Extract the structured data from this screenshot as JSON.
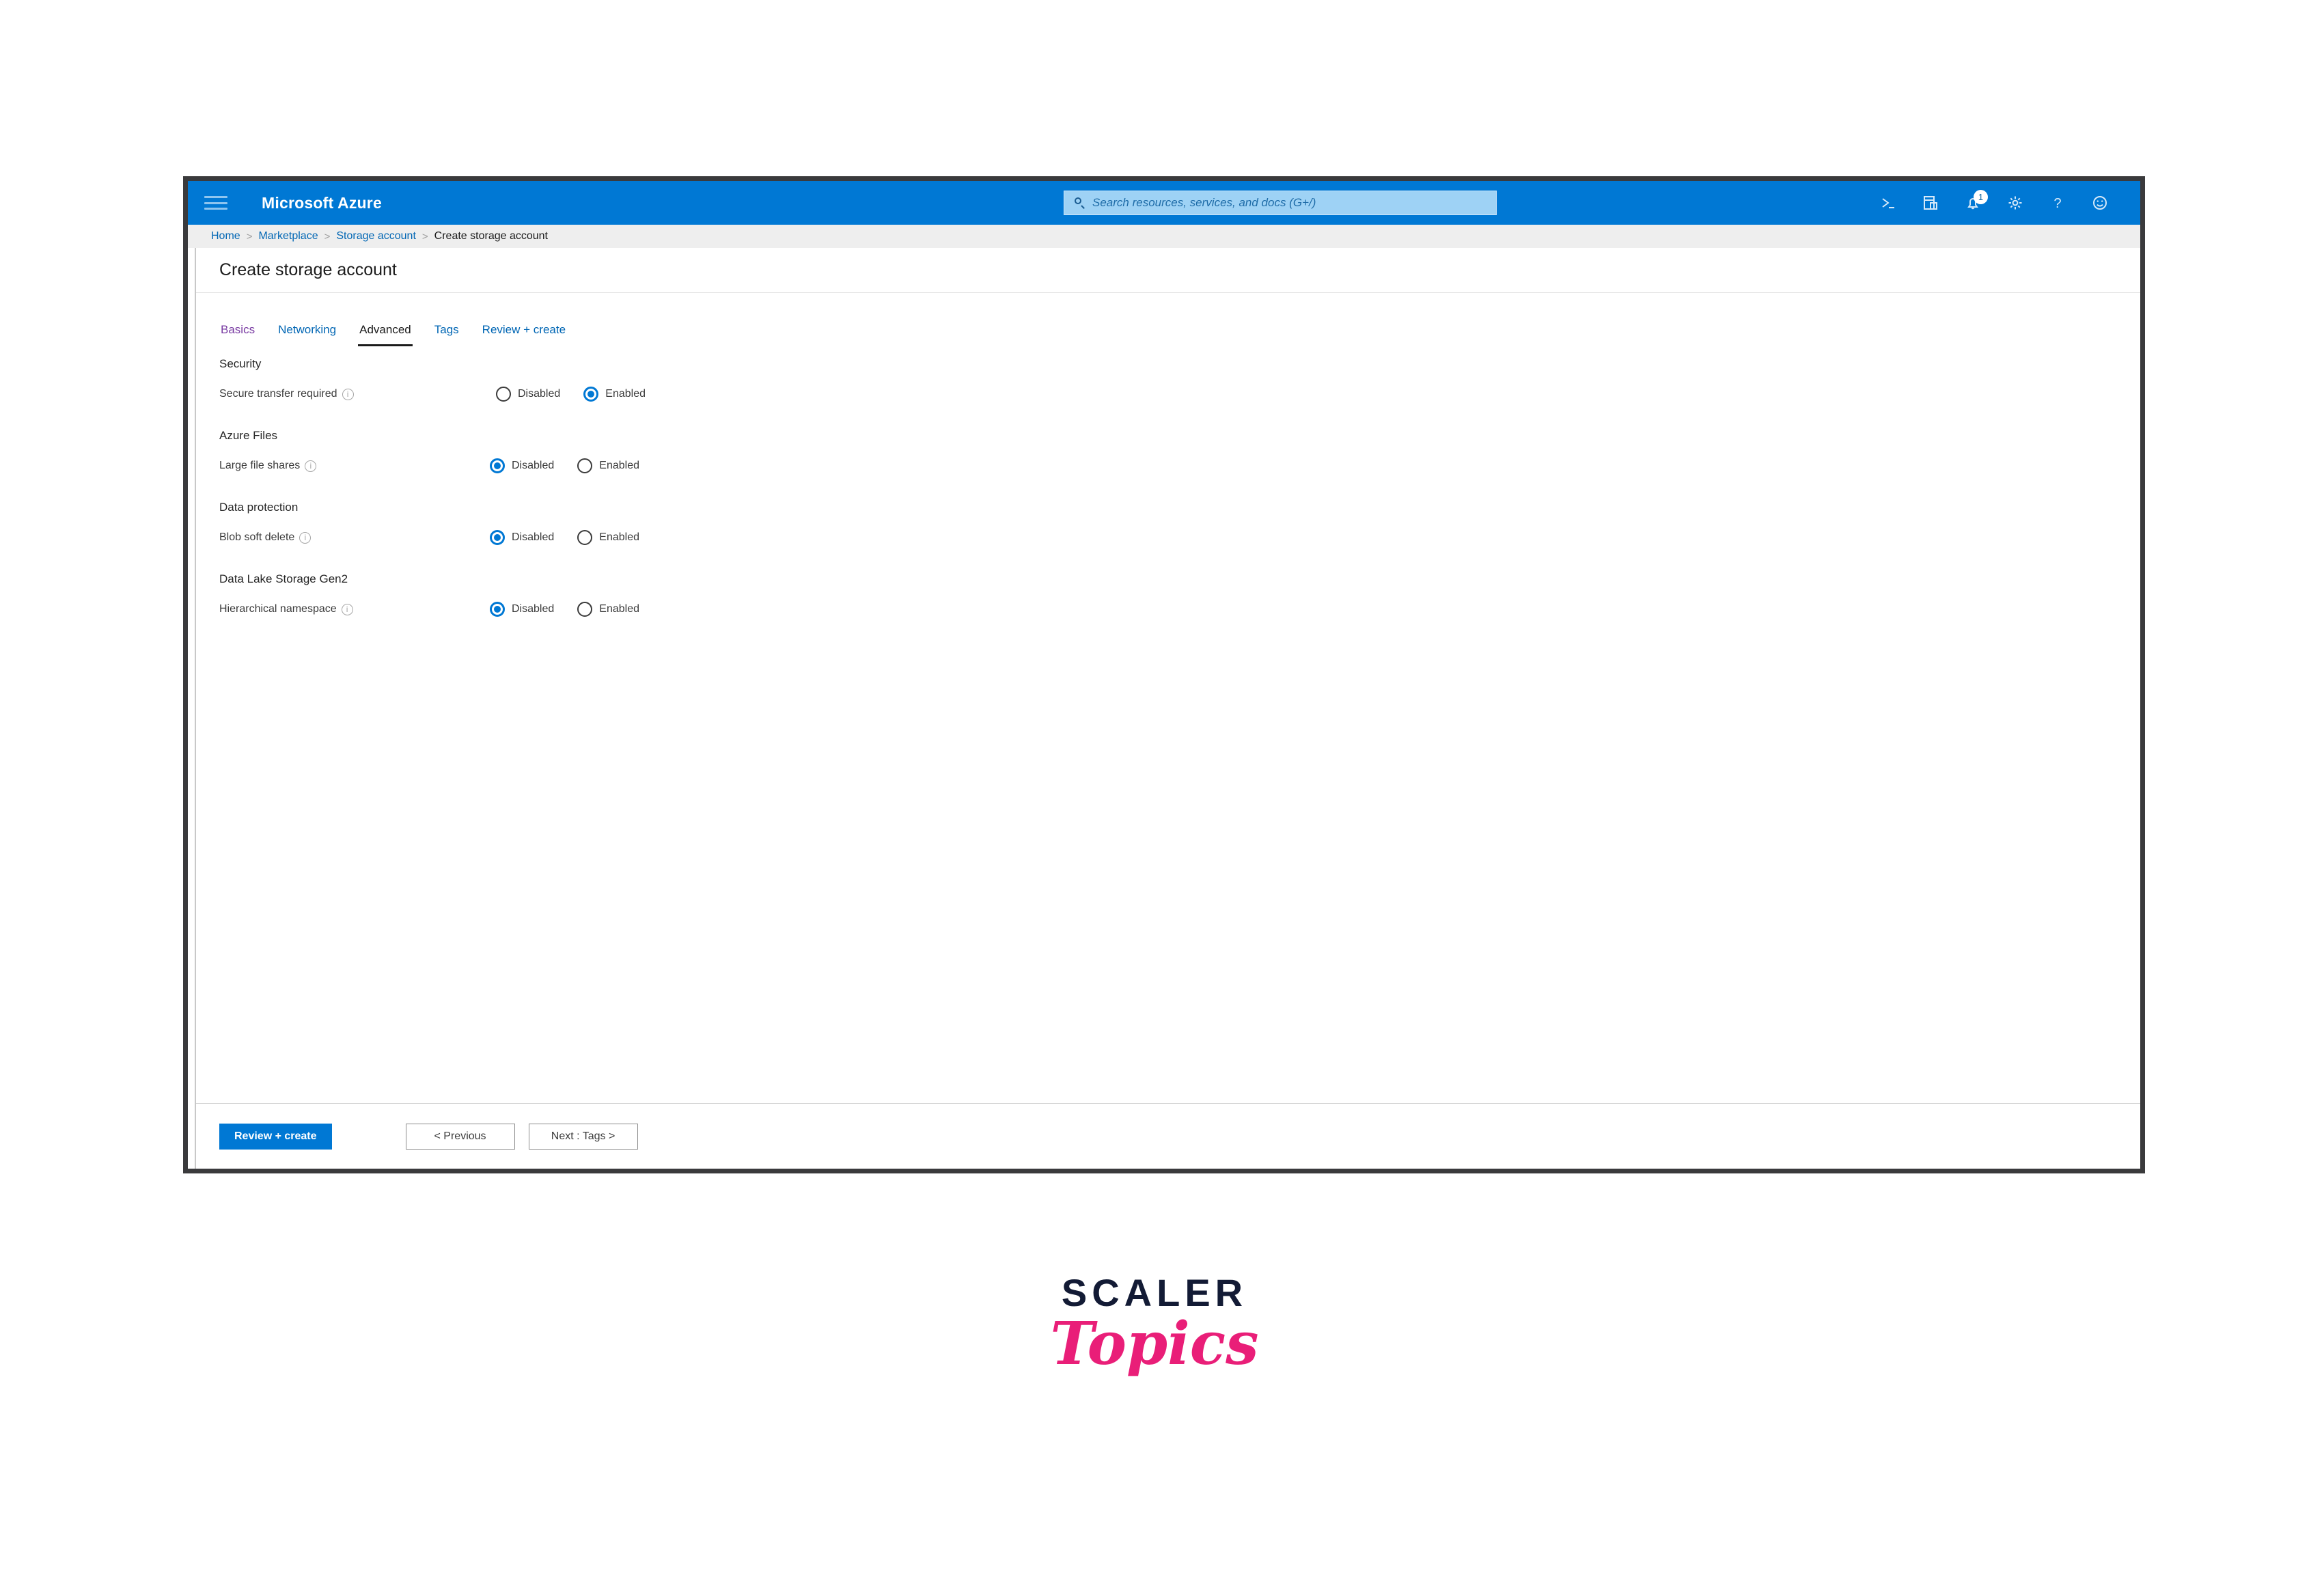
{
  "topbar": {
    "menu_icon": "hamburger-icon",
    "brand": "Microsoft Azure",
    "search": {
      "placeholder": "Search resources, services, and docs (G+/)",
      "value": "",
      "icon": "search-icon"
    },
    "icons": [
      {
        "name": "cloud-shell-icon",
        "glyph": ">_"
      },
      {
        "name": "directories-subscriptions-icon",
        "glyph": "filter"
      },
      {
        "name": "notifications-bell-icon",
        "glyph": "bell",
        "badge": "1"
      },
      {
        "name": "settings-gear-icon",
        "glyph": "gear"
      },
      {
        "name": "help-icon",
        "glyph": "?"
      },
      {
        "name": "feedback-smiley-icon",
        "glyph": "smiley"
      }
    ]
  },
  "breadcrumb": [
    {
      "label": "Home",
      "current": false
    },
    {
      "label": "Marketplace",
      "current": false
    },
    {
      "label": "Storage account",
      "current": false
    },
    {
      "label": "Create storage account",
      "current": true
    }
  ],
  "breadcrumb_separator": ">",
  "blade": {
    "title": "Create storage account",
    "tabs": [
      {
        "label": "Basics",
        "state": "visited"
      },
      {
        "label": "Networking",
        "state": "link"
      },
      {
        "label": "Advanced",
        "state": "active"
      },
      {
        "label": "Tags",
        "state": "link"
      },
      {
        "label": "Review + create",
        "state": "link"
      }
    ],
    "sections": [
      {
        "title": "Security",
        "field": {
          "label": "Secure transfer required",
          "info": "i",
          "options": [
            {
              "label": "Disabled",
              "checked": false
            },
            {
              "label": "Enabled",
              "checked": true
            }
          ]
        }
      },
      {
        "title": "Azure Files",
        "field": {
          "label": "Large file shares",
          "info": "i",
          "options": [
            {
              "label": "Disabled",
              "checked": true
            },
            {
              "label": "Enabled",
              "checked": false
            }
          ]
        }
      },
      {
        "title": "Data protection",
        "field": {
          "label": "Blob soft delete",
          "info": "i",
          "options": [
            {
              "label": "Disabled",
              "checked": true
            },
            {
              "label": "Enabled",
              "checked": false
            }
          ]
        }
      },
      {
        "title": "Data Lake Storage Gen2",
        "field": {
          "label": "Hierarchical namespace",
          "info": "i",
          "options": [
            {
              "label": "Disabled",
              "checked": true
            },
            {
              "label": "Enabled",
              "checked": false
            }
          ]
        }
      }
    ],
    "footer": {
      "review_create": "Review + create",
      "previous": "< Previous",
      "next": "Next : Tags >"
    }
  },
  "watermark": {
    "line1": "SCALER",
    "line2": "Topics"
  },
  "colors": {
    "azure_blue": "#0078d4",
    "link_blue": "#0066b4",
    "visited_purple": "#7a3ca3",
    "logo_navy": "#131b35",
    "logo_pink": "#e91e78"
  }
}
